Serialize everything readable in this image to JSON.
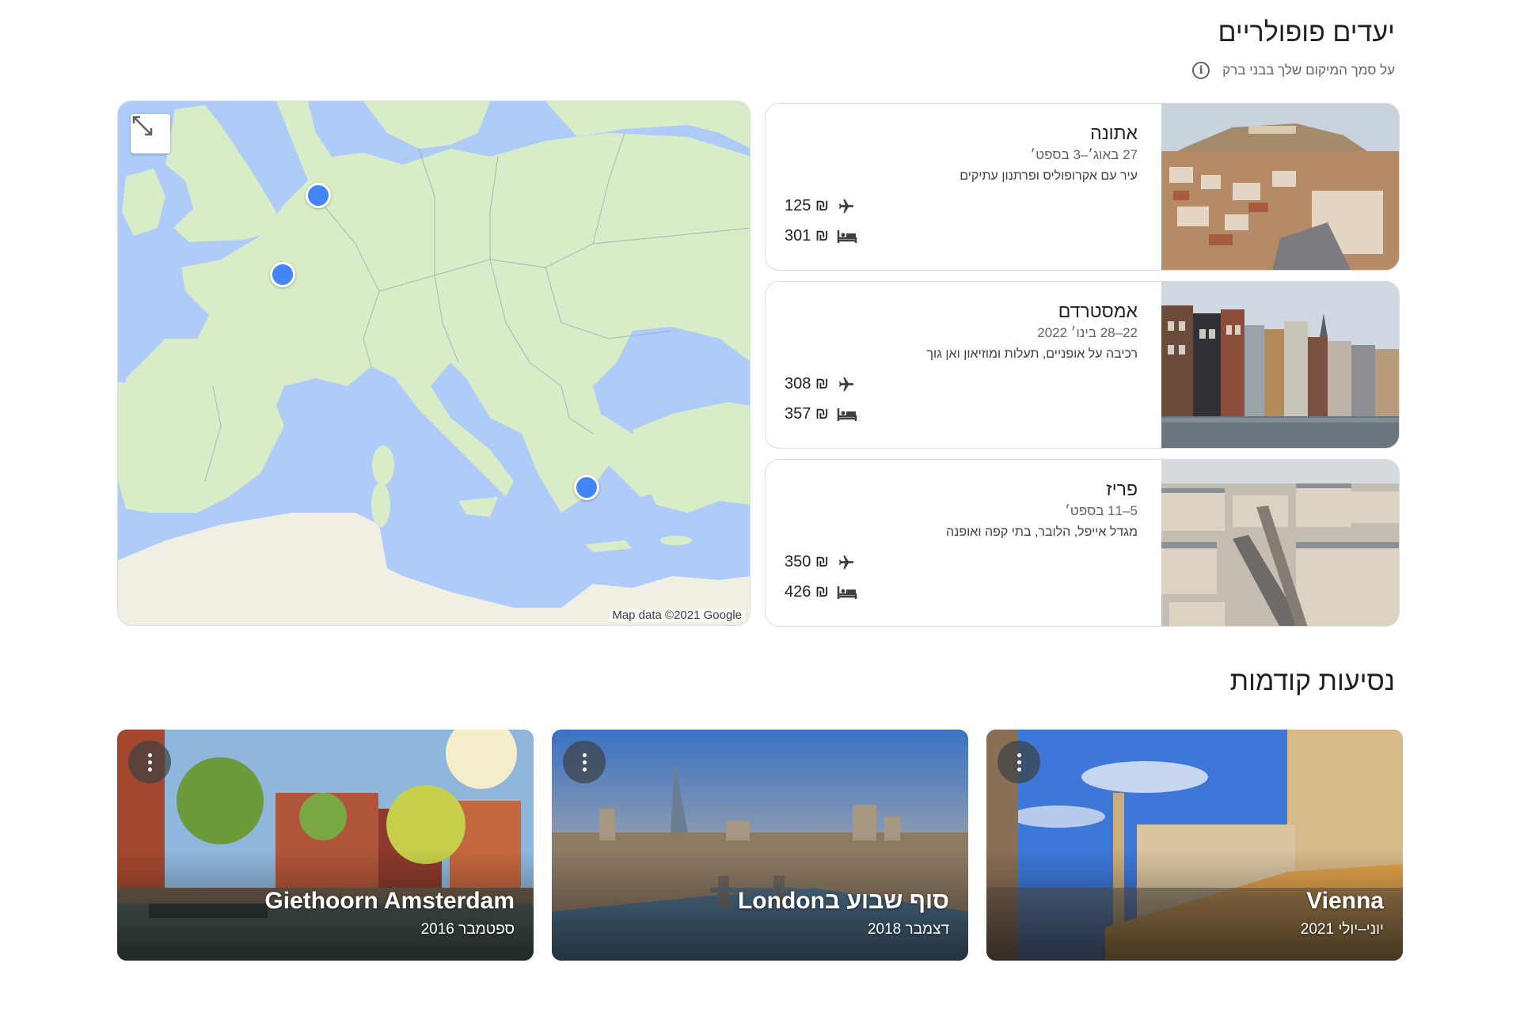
{
  "popular": {
    "title": "יעדים פופולריים",
    "subtitle": "על סמך המיקום שלך בבני ברק",
    "info_icon": "info-icon"
  },
  "map": {
    "credit": "Map data ©2021 Google",
    "expand_icon": "expand-icon",
    "pins": [
      "Amsterdam",
      "Paris",
      "Athens"
    ]
  },
  "destinations": [
    {
      "name": "אתונה",
      "dates": "27 באוג׳–3 בספט׳",
      "description": "עיר עם אקרופוליס ופרתנון עתיקים",
      "flight_price": "125 ₪",
      "hotel_price": "301 ₪"
    },
    {
      "name": "אמסטרדם",
      "dates": "22–28 בינו׳ 2022",
      "description": "רכיבה על אופניים, תעלות ומוזיאון ואן גוך",
      "flight_price": "308 ₪",
      "hotel_price": "357 ₪"
    },
    {
      "name": "פריז",
      "dates": "5–11 בספט׳",
      "description": "מגדל אייפל, הלובר, בתי קפה ואופנה",
      "flight_price": "350 ₪",
      "hotel_price": "426 ₪"
    }
  ],
  "past_trips": {
    "title": "נסיעות קודמות",
    "items": [
      {
        "title": "Vienna",
        "date": "יוני–יולי 2021"
      },
      {
        "title": "סוף שבוע בLondon",
        "date": "דצמבר 2018"
      },
      {
        "title": "Giethoorn Amsterdam",
        "date": "ספטמבר 2016"
      }
    ]
  },
  "colors": {
    "accent": "#4285f4",
    "water": "#aecbfa",
    "land": "#d8ecc8"
  }
}
